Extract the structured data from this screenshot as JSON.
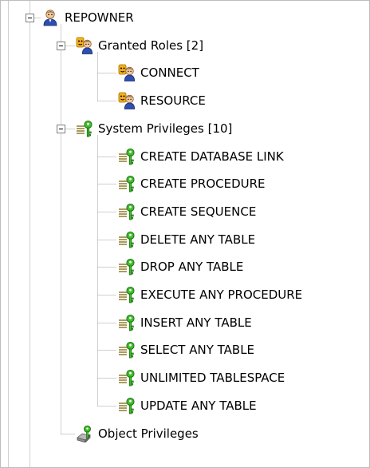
{
  "tree": {
    "root": {
      "label": "REPOWNER",
      "icon": "user-icon",
      "expanded": true
    },
    "groups": [
      {
        "id": "granted-roles",
        "label": "Granted Roles [2]",
        "icon": "role-icon",
        "expanded": true,
        "items": [
          {
            "label": "CONNECT",
            "icon": "role-icon"
          },
          {
            "label": "RESOURCE",
            "icon": "role-icon"
          }
        ]
      },
      {
        "id": "system-privileges",
        "label": "System Privileges [10]",
        "icon": "keys-icon",
        "expanded": true,
        "items": [
          {
            "label": "CREATE DATABASE LINK",
            "icon": "keys-icon"
          },
          {
            "label": "CREATE PROCEDURE",
            "icon": "keys-icon"
          },
          {
            "label": "CREATE SEQUENCE",
            "icon": "keys-icon"
          },
          {
            "label": "DELETE ANY TABLE",
            "icon": "keys-icon"
          },
          {
            "label": "DROP ANY TABLE",
            "icon": "keys-icon"
          },
          {
            "label": "EXECUTE ANY PROCEDURE",
            "icon": "keys-icon"
          },
          {
            "label": "INSERT ANY TABLE",
            "icon": "keys-icon"
          },
          {
            "label": "SELECT ANY TABLE",
            "icon": "keys-icon"
          },
          {
            "label": "UNLIMITED TABLESPACE",
            "icon": "keys-icon"
          },
          {
            "label": "UPDATE ANY TABLE",
            "icon": "keys-icon"
          }
        ]
      },
      {
        "id": "object-privileges",
        "label": "Object Privileges",
        "icon": "object-privilege-icon",
        "expanded": false,
        "items": []
      }
    ]
  }
}
